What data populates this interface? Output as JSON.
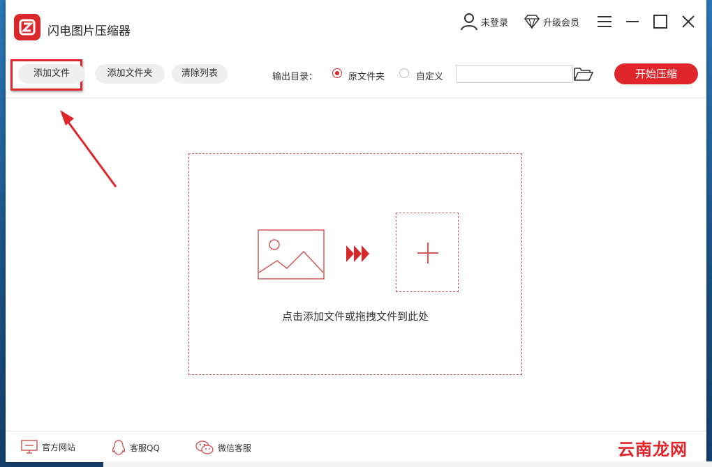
{
  "app": {
    "title": "闪电图片压缩器",
    "brand_color": "#e0262b"
  },
  "titlebar": {
    "login_label": "未登录",
    "upgrade_label": "升级会员",
    "icons": [
      "user-icon",
      "diamond-icon",
      "menu-icon",
      "minimize-icon",
      "maximize-icon",
      "close-icon"
    ]
  },
  "toolbar": {
    "add_file_label": "添加文件",
    "add_folder_label": "添加文件夹",
    "clear_list_label": "清除列表",
    "output_dir_label": "输出目录：",
    "option_original": "原文件夹",
    "option_custom": "自定义",
    "selected_option": "原文件夹",
    "path_value": "",
    "start_label": "开始压缩"
  },
  "dropzone": {
    "hint": "点击添加文件或拖拽文件到此处"
  },
  "footer": {
    "website_label": "官方网站",
    "qq_label": "客服QQ",
    "wechat_label": "微信客服"
  },
  "watermark": {
    "text": "云南龙网"
  }
}
